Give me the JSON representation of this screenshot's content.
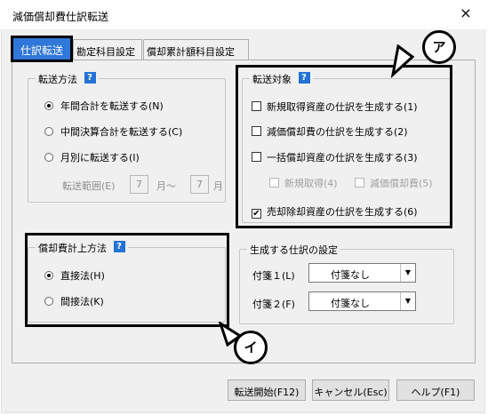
{
  "window": {
    "title": "減価償却費仕訳転送",
    "close_label": "×"
  },
  "tabs": {
    "active": "仕訳転送",
    "items": [
      "勘定科目設定",
      "償却累計額科目設定"
    ]
  },
  "transfer_method": {
    "title": "転送方法",
    "help": "?",
    "options": [
      "年間合計を転送する(N)",
      "中間決算合計を転送する(C)",
      "月別に転送する(I)"
    ],
    "selected_index": 0,
    "range_label": "転送範囲(E)",
    "range_from": "7",
    "month_sep": "月～",
    "range_to": "7",
    "month_suffix": "月"
  },
  "depreciation_method": {
    "title": "償却費計上方法",
    "help": "?",
    "options": [
      "直接法(H)",
      "間接法(K)"
    ],
    "selected_index": 0
  },
  "transfer_target": {
    "title": "転送対象",
    "help": "?",
    "items": [
      {
        "label": "新規取得資産の仕訳を生成する(1)",
        "checked": false
      },
      {
        "label": "減価償却費の仕訳を生成する(2)",
        "checked": false
      },
      {
        "label": "一括償却資産の仕訳を生成する(3)",
        "checked": false
      },
      {
        "label": "売却除却資産の仕訳を生成する(6)",
        "checked": true
      }
    ],
    "sub_items": [
      {
        "label": "新規取得(4)",
        "checked": false,
        "enabled": false
      },
      {
        "label": "減価償却費(5)",
        "checked": false,
        "enabled": false
      }
    ]
  },
  "journal_settings": {
    "title": "生成する仕訳の設定",
    "fields": [
      {
        "label": "付箋１(L)",
        "value": "付箋なし"
      },
      {
        "label": "付箋２(F)",
        "value": "付箋なし"
      }
    ]
  },
  "buttons": {
    "start": "転送開始(F12)",
    "cancel": "キャンセル(Esc)",
    "help": "ヘルプ(F1)"
  },
  "callouts": {
    "a": "ア",
    "i": "イ"
  },
  "check_mark": "✔",
  "dropdown_arrow": "▼"
}
